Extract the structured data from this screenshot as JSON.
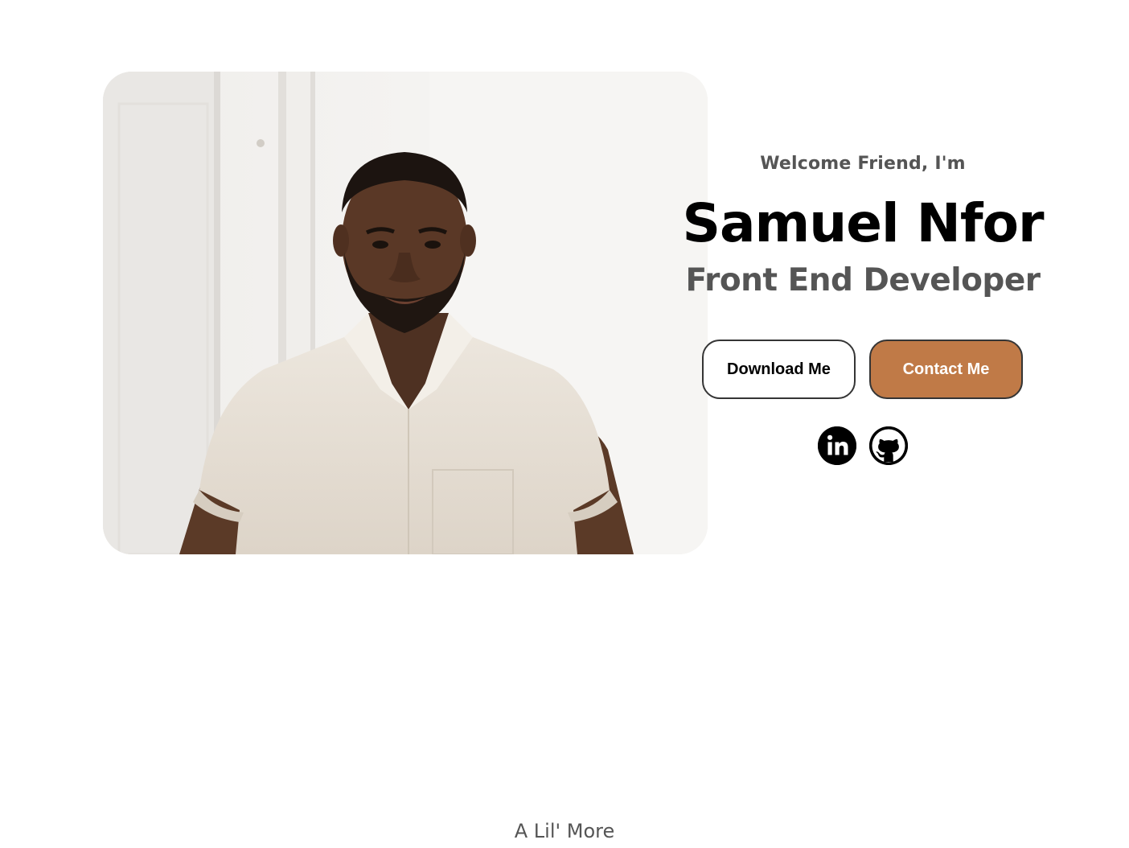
{
  "profile": {
    "photo_alt": "Samuel Nfor profile picture",
    "greeting": "Welcome Friend, I'm",
    "name": "Samuel Nfor",
    "role": "Front End Developer"
  },
  "actions": {
    "download_label": "Download Me",
    "contact_label": "Contact Me"
  },
  "social": {
    "linkedin_icon": "linkedin-icon",
    "github_icon": "github-icon"
  },
  "footer": {
    "more_label": "A Lil' More"
  },
  "colors": {
    "accent": "#c07a47",
    "muted_text": "#555555",
    "primary_text": "#000000",
    "border": "#353535"
  }
}
